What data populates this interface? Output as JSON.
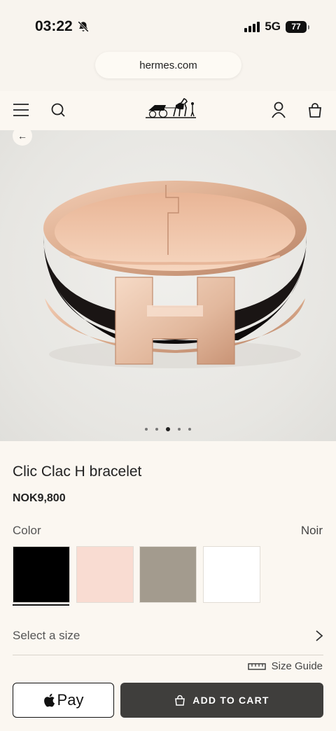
{
  "status_bar": {
    "time": "03:22",
    "network": "5G",
    "battery": "77"
  },
  "browser": {
    "url": "hermes.com"
  },
  "header": {
    "menu_icon": "menu-icon",
    "search_icon": "search-icon",
    "logo": "hermes-carriage-logo",
    "account_icon": "user-icon",
    "bag_icon": "shopping-bag-icon"
  },
  "gallery": {
    "image": "black-enamel-rose-gold-bracelet",
    "total_images": 5,
    "active_index": 3
  },
  "product": {
    "title": "Clic Clac H bracelet",
    "price": "NOK9,800",
    "color_label": "Color",
    "color_value": "Noir",
    "swatches": [
      {
        "name": "Noir",
        "color": "#000000",
        "selected": true
      },
      {
        "name": "Rose",
        "color": "#f9dcd2",
        "selected": false
      },
      {
        "name": "Taupe",
        "color": "#a39b8e",
        "selected": false
      },
      {
        "name": "Blanc",
        "color": "#ffffff",
        "selected": false
      }
    ],
    "size_label": "Select a size",
    "size_guide": "Size Guide"
  },
  "actions": {
    "apple_pay": "Pay",
    "add_to_cart": "ADD TO CART"
  },
  "colors": {
    "background": "#fbf7f1",
    "button_dark": "#3f3e3c",
    "rose_gold": "#d9a98a"
  }
}
